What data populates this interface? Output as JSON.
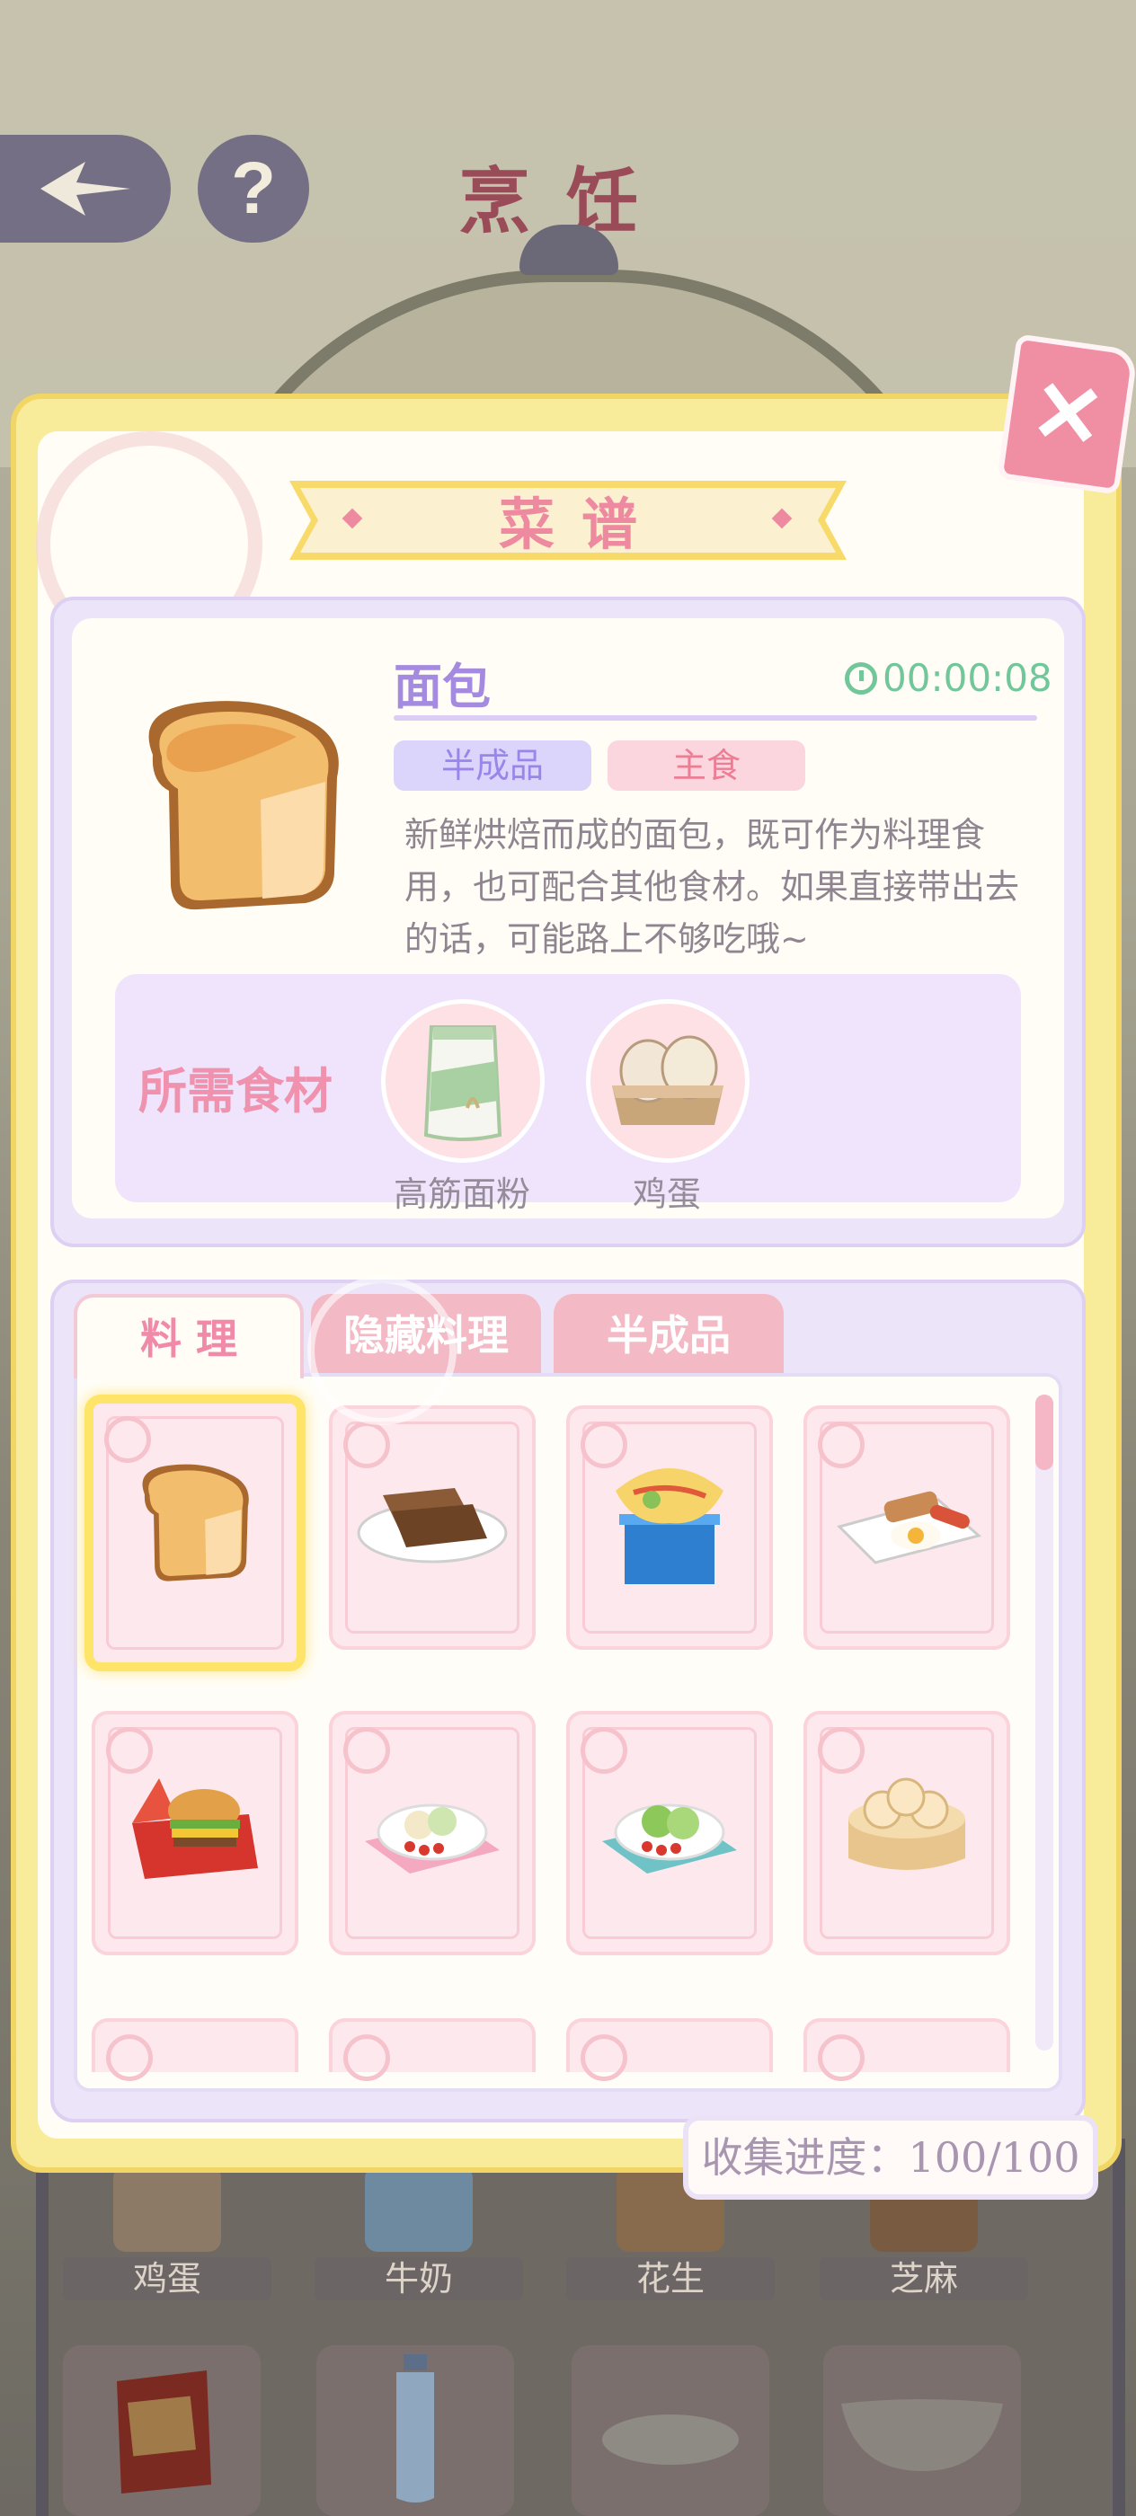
{
  "header": {
    "title": "烹饪"
  },
  "dialog": {
    "banner_title": "菜谱",
    "detail": {
      "name": "面包",
      "timer": "00:00:08",
      "tags": [
        "半成品",
        "主食"
      ],
      "description": "新鲜烘焙而成的面包，既可作为料理食用，也可配合其他食材。如果直接带出去的话，可能路上不够吃哦~"
    },
    "ingredients": {
      "title": "所需食材",
      "items": [
        {
          "name": "高筋面粉",
          "icon": "flour-bag-icon"
        },
        {
          "name": "鸡蛋",
          "icon": "egg-carton-icon"
        }
      ]
    },
    "tabs": [
      {
        "label": "料 理",
        "selected": true
      },
      {
        "label": "隐藏料理",
        "selected": false
      },
      {
        "label": "半成品",
        "selected": false
      }
    ],
    "recipes": [
      {
        "icon": "bread-icon",
        "selected": true
      },
      {
        "icon": "toast-icon",
        "selected": false
      },
      {
        "icon": "omelette-lunchbox-icon",
        "selected": false
      },
      {
        "icon": "breakfast-plate-icon",
        "selected": false
      },
      {
        "icon": "burger-box-icon",
        "selected": false
      },
      {
        "icon": "salad-plate-icon",
        "selected": false
      },
      {
        "icon": "green-salad-icon",
        "selected": false
      },
      {
        "icon": "steamed-buns-icon",
        "selected": false
      }
    ],
    "progress": "收集进度：100/100"
  },
  "background_items": {
    "labels": [
      "鸡蛋",
      "牛奶",
      "花生",
      "芝麻"
    ]
  },
  "colors": {
    "accent_pink": "#ee8aa0",
    "accent_purple": "#a48be0",
    "timer_green": "#71c79a",
    "frame_yellow": "#f7da6a"
  }
}
